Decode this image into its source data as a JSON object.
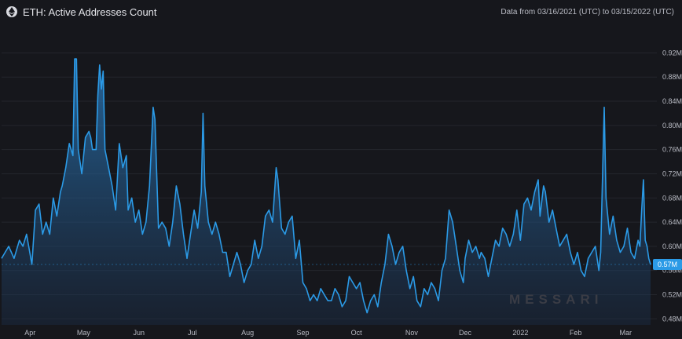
{
  "header": {
    "title": "ETH: Active Addresses Count",
    "date_range": "Data from 03/16/2021 (UTC) to 03/15/2022 (UTC)",
    "icon": "ethereum-icon"
  },
  "watermark": "MESSARI",
  "last_value_label": "0.57M",
  "colors": {
    "line": "#2b9ae6",
    "background": "#16171c",
    "grid": "#24262d"
  },
  "chart_data": {
    "type": "area",
    "title": "ETH: Active Addresses Count",
    "x_start": "2021-03-16",
    "x_end": "2022-03-15",
    "x_ticks": [
      {
        "label": "Apr",
        "date": "2021-04-01"
      },
      {
        "label": "May",
        "date": "2021-05-01"
      },
      {
        "label": "Jun",
        "date": "2021-06-01"
      },
      {
        "label": "Jul",
        "date": "2021-07-01"
      },
      {
        "label": "Aug",
        "date": "2021-08-01"
      },
      {
        "label": "Sep",
        "date": "2021-09-01"
      },
      {
        "label": "Oct",
        "date": "2021-10-01"
      },
      {
        "label": "Nov",
        "date": "2021-11-01"
      },
      {
        "label": "Dec",
        "date": "2021-12-01"
      },
      {
        "label": "2022",
        "date": "2022-01-01"
      },
      {
        "label": "Feb",
        "date": "2022-02-01"
      },
      {
        "label": "Mar",
        "date": "2022-03-01"
      }
    ],
    "y_ticks": [
      {
        "label": "0.48M",
        "value": 0.48
      },
      {
        "label": "0.52M",
        "value": 0.52
      },
      {
        "label": "0.56M",
        "value": 0.56
      },
      {
        "label": "0.60M",
        "value": 0.6
      },
      {
        "label": "0.64M",
        "value": 0.64
      },
      {
        "label": "0.68M",
        "value": 0.68
      },
      {
        "label": "0.72M",
        "value": 0.72
      },
      {
        "label": "0.76M",
        "value": 0.76
      },
      {
        "label": "0.80M",
        "value": 0.8
      },
      {
        "label": "0.84M",
        "value": 0.84
      },
      {
        "label": "0.88M",
        "value": 0.88
      },
      {
        "label": "0.92M",
        "value": 0.92
      }
    ],
    "ylim": [
      0.47,
      0.94
    ],
    "y_unit": "M",
    "grid": true,
    "series": [
      {
        "points": [
          [
            "2021-03-16",
            0.58
          ],
          [
            "2021-03-18",
            0.59
          ],
          [
            "2021-03-20",
            0.6
          ],
          [
            "2021-03-23",
            0.58
          ],
          [
            "2021-03-26",
            0.61
          ],
          [
            "2021-03-28",
            0.6
          ],
          [
            "2021-03-30",
            0.62
          ],
          [
            "2021-04-02",
            0.57
          ],
          [
            "2021-04-04",
            0.66
          ],
          [
            "2021-04-06",
            0.67
          ],
          [
            "2021-04-08",
            0.62
          ],
          [
            "2021-04-10",
            0.64
          ],
          [
            "2021-04-12",
            0.62
          ],
          [
            "2021-04-14",
            0.68
          ],
          [
            "2021-04-16",
            0.65
          ],
          [
            "2021-04-18",
            0.69
          ],
          [
            "2021-04-19",
            0.7
          ],
          [
            "2021-04-21",
            0.73
          ],
          [
            "2021-04-23",
            0.77
          ],
          [
            "2021-04-25",
            0.75
          ],
          [
            "2021-04-26",
            0.91
          ],
          [
            "2021-04-27",
            0.91
          ],
          [
            "2021-04-28",
            0.76
          ],
          [
            "2021-04-30",
            0.72
          ],
          [
            "2021-05-02",
            0.78
          ],
          [
            "2021-05-04",
            0.79
          ],
          [
            "2021-05-05",
            0.78
          ],
          [
            "2021-05-06",
            0.76
          ],
          [
            "2021-05-08",
            0.76
          ],
          [
            "2021-05-09",
            0.85
          ],
          [
            "2021-05-10",
            0.9
          ],
          [
            "2021-05-11",
            0.86
          ],
          [
            "2021-05-12",
            0.89
          ],
          [
            "2021-05-13",
            0.76
          ],
          [
            "2021-05-15",
            0.73
          ],
          [
            "2021-05-17",
            0.7
          ],
          [
            "2021-05-19",
            0.66
          ],
          [
            "2021-05-21",
            0.77
          ],
          [
            "2021-05-23",
            0.73
          ],
          [
            "2021-05-25",
            0.75
          ],
          [
            "2021-05-26",
            0.66
          ],
          [
            "2021-05-28",
            0.68
          ],
          [
            "2021-05-30",
            0.64
          ],
          [
            "2021-06-01",
            0.66
          ],
          [
            "2021-06-03",
            0.62
          ],
          [
            "2021-06-05",
            0.64
          ],
          [
            "2021-06-07",
            0.7
          ],
          [
            "2021-06-09",
            0.83
          ],
          [
            "2021-06-10",
            0.81
          ],
          [
            "2021-06-12",
            0.63
          ],
          [
            "2021-06-14",
            0.64
          ],
          [
            "2021-06-16",
            0.63
          ],
          [
            "2021-06-18",
            0.6
          ],
          [
            "2021-06-20",
            0.64
          ],
          [
            "2021-06-22",
            0.7
          ],
          [
            "2021-06-24",
            0.67
          ],
          [
            "2021-06-26",
            0.62
          ],
          [
            "2021-06-28",
            0.58
          ],
          [
            "2021-06-30",
            0.62
          ],
          [
            "2021-07-02",
            0.66
          ],
          [
            "2021-07-04",
            0.63
          ],
          [
            "2021-07-06",
            0.69
          ],
          [
            "2021-07-07",
            0.82
          ],
          [
            "2021-07-08",
            0.7
          ],
          [
            "2021-07-10",
            0.64
          ],
          [
            "2021-07-12",
            0.62
          ],
          [
            "2021-07-14",
            0.64
          ],
          [
            "2021-07-16",
            0.62
          ],
          [
            "2021-07-18",
            0.59
          ],
          [
            "2021-07-20",
            0.59
          ],
          [
            "2021-07-22",
            0.55
          ],
          [
            "2021-07-24",
            0.57
          ],
          [
            "2021-07-26",
            0.59
          ],
          [
            "2021-07-28",
            0.57
          ],
          [
            "2021-07-30",
            0.54
          ],
          [
            "2021-08-01",
            0.56
          ],
          [
            "2021-08-03",
            0.57
          ],
          [
            "2021-08-05",
            0.61
          ],
          [
            "2021-08-07",
            0.58
          ],
          [
            "2021-08-09",
            0.6
          ],
          [
            "2021-08-11",
            0.65
          ],
          [
            "2021-08-13",
            0.66
          ],
          [
            "2021-08-15",
            0.64
          ],
          [
            "2021-08-17",
            0.73
          ],
          [
            "2021-08-18",
            0.71
          ],
          [
            "2021-08-20",
            0.63
          ],
          [
            "2021-08-22",
            0.62
          ],
          [
            "2021-08-24",
            0.64
          ],
          [
            "2021-08-26",
            0.65
          ],
          [
            "2021-08-28",
            0.58
          ],
          [
            "2021-08-30",
            0.61
          ],
          [
            "2021-09-01",
            0.54
          ],
          [
            "2021-09-03",
            0.53
          ],
          [
            "2021-09-05",
            0.51
          ],
          [
            "2021-09-07",
            0.52
          ],
          [
            "2021-09-09",
            0.51
          ],
          [
            "2021-09-11",
            0.53
          ],
          [
            "2021-09-13",
            0.52
          ],
          [
            "2021-09-15",
            0.51
          ],
          [
            "2021-09-17",
            0.51
          ],
          [
            "2021-09-19",
            0.53
          ],
          [
            "2021-09-21",
            0.52
          ],
          [
            "2021-09-23",
            0.5
          ],
          [
            "2021-09-25",
            0.51
          ],
          [
            "2021-09-27",
            0.55
          ],
          [
            "2021-09-29",
            0.54
          ],
          [
            "2021-10-01",
            0.53
          ],
          [
            "2021-10-03",
            0.54
          ],
          [
            "2021-10-05",
            0.51
          ],
          [
            "2021-10-07",
            0.49
          ],
          [
            "2021-10-09",
            0.51
          ],
          [
            "2021-10-11",
            0.52
          ],
          [
            "2021-10-13",
            0.5
          ],
          [
            "2021-10-15",
            0.54
          ],
          [
            "2021-10-17",
            0.57
          ],
          [
            "2021-10-19",
            0.62
          ],
          [
            "2021-10-21",
            0.6
          ],
          [
            "2021-10-23",
            0.57
          ],
          [
            "2021-10-25",
            0.59
          ],
          [
            "2021-10-27",
            0.6
          ],
          [
            "2021-10-29",
            0.56
          ],
          [
            "2021-10-31",
            0.53
          ],
          [
            "2021-11-02",
            0.55
          ],
          [
            "2021-11-04",
            0.51
          ],
          [
            "2021-11-06",
            0.5
          ],
          [
            "2021-11-08",
            0.53
          ],
          [
            "2021-11-10",
            0.52
          ],
          [
            "2021-11-12",
            0.54
          ],
          [
            "2021-11-14",
            0.53
          ],
          [
            "2021-11-16",
            0.51
          ],
          [
            "2021-11-18",
            0.56
          ],
          [
            "2021-11-20",
            0.58
          ],
          [
            "2021-11-22",
            0.66
          ],
          [
            "2021-11-24",
            0.64
          ],
          [
            "2021-11-26",
            0.6
          ],
          [
            "2021-11-28",
            0.56
          ],
          [
            "2021-11-30",
            0.54
          ],
          [
            "2021-12-01",
            0.58
          ],
          [
            "2021-12-03",
            0.61
          ],
          [
            "2021-12-05",
            0.59
          ],
          [
            "2021-12-07",
            0.6
          ],
          [
            "2021-12-09",
            0.58
          ],
          [
            "2021-12-10",
            0.59
          ],
          [
            "2021-12-12",
            0.58
          ],
          [
            "2021-12-14",
            0.55
          ],
          [
            "2021-12-16",
            0.58
          ],
          [
            "2021-12-18",
            0.61
          ],
          [
            "2021-12-20",
            0.6
          ],
          [
            "2021-12-22",
            0.63
          ],
          [
            "2021-12-24",
            0.62
          ],
          [
            "2021-12-26",
            0.6
          ],
          [
            "2021-12-28",
            0.62
          ],
          [
            "2021-12-30",
            0.66
          ],
          [
            "2022-01-01",
            0.61
          ],
          [
            "2022-01-03",
            0.67
          ],
          [
            "2022-01-05",
            0.68
          ],
          [
            "2022-01-07",
            0.66
          ],
          [
            "2022-01-09",
            0.69
          ],
          [
            "2022-01-11",
            0.71
          ],
          [
            "2022-01-12",
            0.65
          ],
          [
            "2022-01-14",
            0.7
          ],
          [
            "2022-01-15",
            0.69
          ],
          [
            "2022-01-17",
            0.64
          ],
          [
            "2022-01-19",
            0.66
          ],
          [
            "2022-01-21",
            0.63
          ],
          [
            "2022-01-23",
            0.6
          ],
          [
            "2022-01-25",
            0.61
          ],
          [
            "2022-01-27",
            0.62
          ],
          [
            "2022-01-29",
            0.59
          ],
          [
            "2022-01-31",
            0.57
          ],
          [
            "2022-02-02",
            0.59
          ],
          [
            "2022-02-04",
            0.56
          ],
          [
            "2022-02-06",
            0.55
          ],
          [
            "2022-02-08",
            0.58
          ],
          [
            "2022-02-10",
            0.59
          ],
          [
            "2022-02-12",
            0.6
          ],
          [
            "2022-02-14",
            0.56
          ],
          [
            "2022-02-15",
            0.59
          ],
          [
            "2022-02-17",
            0.83
          ],
          [
            "2022-02-18",
            0.68
          ],
          [
            "2022-02-20",
            0.62
          ],
          [
            "2022-02-22",
            0.65
          ],
          [
            "2022-02-24",
            0.61
          ],
          [
            "2022-02-26",
            0.59
          ],
          [
            "2022-02-28",
            0.6
          ],
          [
            "2022-03-02",
            0.63
          ],
          [
            "2022-03-04",
            0.59
          ],
          [
            "2022-03-06",
            0.58
          ],
          [
            "2022-03-08",
            0.61
          ],
          [
            "2022-03-09",
            0.6
          ],
          [
            "2022-03-10",
            0.66
          ],
          [
            "2022-03-11",
            0.71
          ],
          [
            "2022-03-12",
            0.61
          ],
          [
            "2022-03-13",
            0.6
          ],
          [
            "2022-03-14",
            0.58
          ],
          [
            "2022-03-15",
            0.57
          ]
        ]
      }
    ]
  }
}
